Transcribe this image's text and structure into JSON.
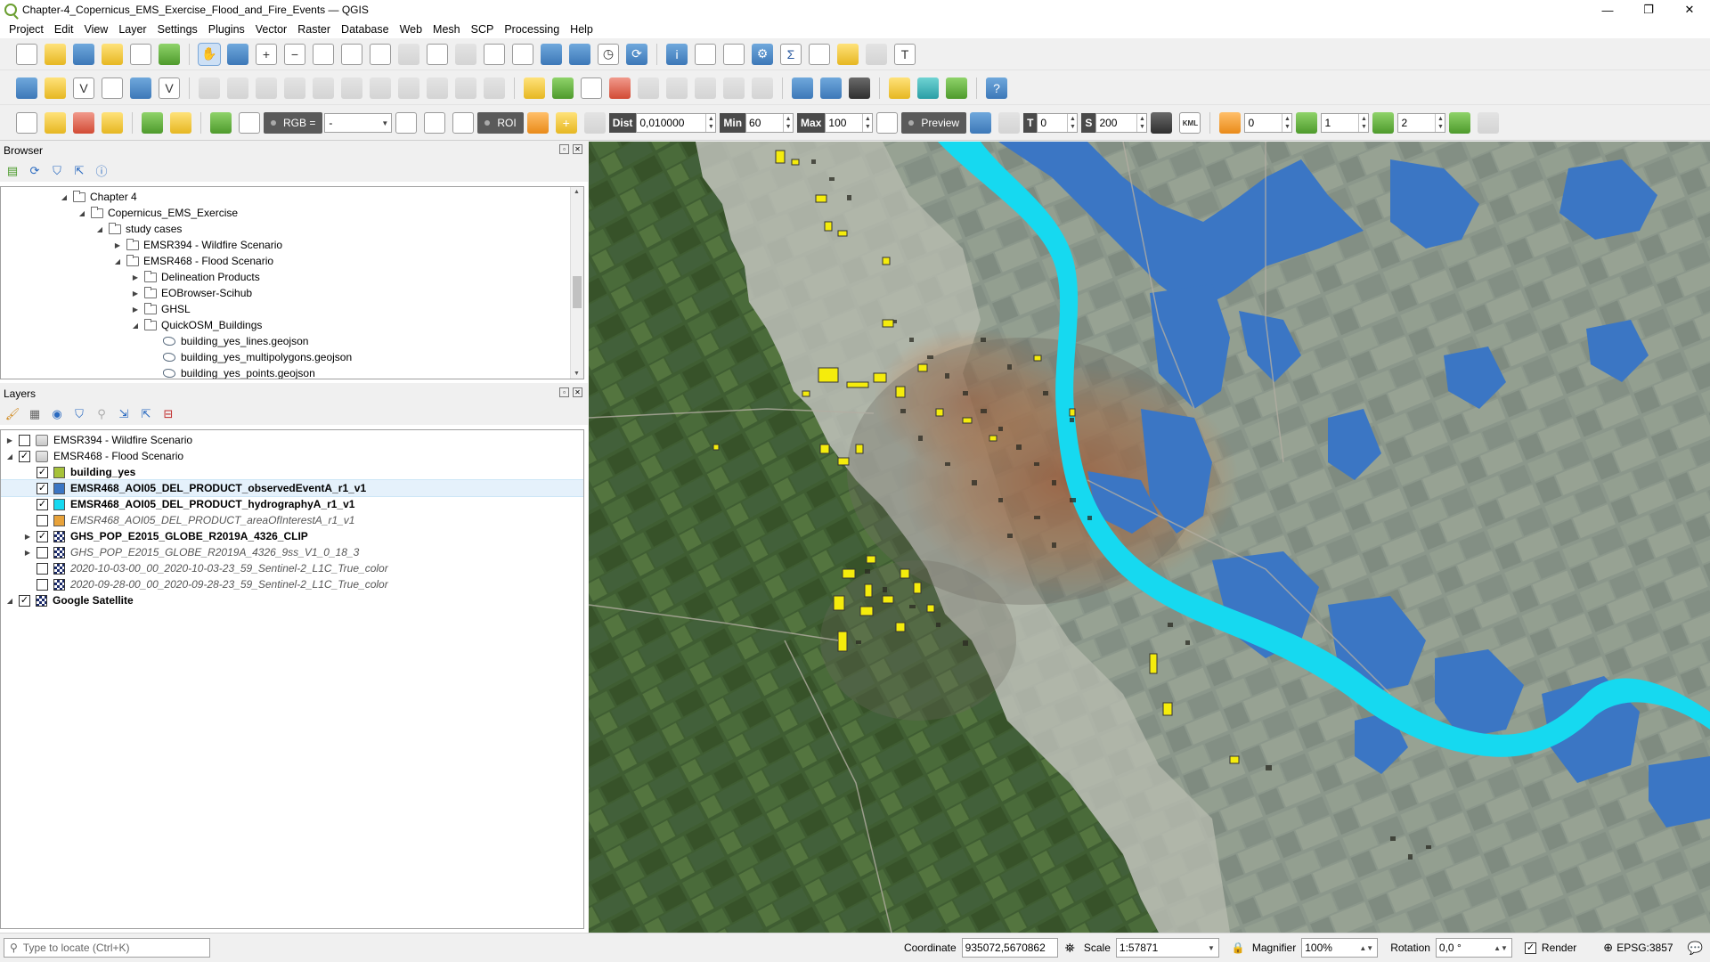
{
  "window": {
    "title": "Chapter-4_Copernicus_EMS_Exercise_Flood_and_Fire_Events — QGIS",
    "controls": {
      "minimize": "—",
      "restore": "❐",
      "close": "✕"
    }
  },
  "menu": [
    "Project",
    "Edit",
    "View",
    "Layer",
    "Settings",
    "Plugins",
    "Vector",
    "Raster",
    "Database",
    "Web",
    "Mesh",
    "SCP",
    "Processing",
    "Help"
  ],
  "scp_toolbar": {
    "rgb_label": "RGB =",
    "rgb_value": "-",
    "roi_label": "ROI",
    "dist_label": "Dist",
    "dist_value": "0,010000",
    "min_label": "Min",
    "min_value": "60",
    "max_label": "Max",
    "max_value": "100",
    "preview_label": "Preview",
    "t_label": "T",
    "t_value": "0",
    "s_label": "S",
    "s_value": "200",
    "kml_label": "KML",
    "band_a": "0",
    "band_b": "1",
    "band_c": "2"
  },
  "browser": {
    "title": "Browser",
    "items": [
      {
        "label": "Chapter 4",
        "indent": 0,
        "expander": "open",
        "icon": "folder"
      },
      {
        "label": "Copernicus_EMS_Exercise",
        "indent": 1,
        "expander": "open",
        "icon": "folder"
      },
      {
        "label": "study cases",
        "indent": 2,
        "expander": "open",
        "icon": "folder"
      },
      {
        "label": "EMSR394 - Wildfire Scenario",
        "indent": 3,
        "expander": "closed",
        "icon": "folder"
      },
      {
        "label": "EMSR468 - Flood Scenario",
        "indent": 3,
        "expander": "open",
        "icon": "folder"
      },
      {
        "label": "Delineation Products",
        "indent": 4,
        "expander": "closed",
        "icon": "folder"
      },
      {
        "label": "EOBrowser-Scihub",
        "indent": 4,
        "expander": "closed",
        "icon": "folder"
      },
      {
        "label": "GHSL",
        "indent": 4,
        "expander": "closed",
        "icon": "folder"
      },
      {
        "label": "QuickOSM_Buildings",
        "indent": 4,
        "expander": "open",
        "icon": "folder"
      },
      {
        "label": "building_yes_lines.geojson",
        "indent": 5,
        "expander": "none",
        "icon": "geojson"
      },
      {
        "label": "building_yes_multipolygons.geojson",
        "indent": 5,
        "expander": "none",
        "icon": "geojson"
      },
      {
        "label": "building_yes_points.geojson",
        "indent": 5,
        "expander": "none",
        "icon": "geojson"
      }
    ]
  },
  "layers": {
    "title": "Layers",
    "items": [
      {
        "label": "EMSR394 - Wildfire Scenario",
        "indent": 0,
        "expander": "closed",
        "checked": false,
        "sym": "group",
        "style": "normal"
      },
      {
        "label": "EMSR468 - Flood Scenario",
        "indent": 0,
        "expander": "open",
        "checked": true,
        "sym": "group",
        "style": "normal"
      },
      {
        "label": "building_yes",
        "indent": 1,
        "expander": "none",
        "checked": true,
        "sym": "fill",
        "color": "#a6c23a",
        "style": "bold"
      },
      {
        "label": "EMSR468_AOI05_DEL_PRODUCT_observedEventA_r1_v1",
        "indent": 1,
        "expander": "none",
        "checked": true,
        "sym": "fill",
        "color": "#3b76c4",
        "style": "bold",
        "highlight": true
      },
      {
        "label": "EMSR468_AOI05_DEL_PRODUCT_hydrographyA_r1_v1",
        "indent": 1,
        "expander": "none",
        "checked": true,
        "sym": "fill",
        "color": "#16d9f0",
        "style": "bold"
      },
      {
        "label": "EMSR468_AOI05_DEL_PRODUCT_areaOfInterestA_r1_v1",
        "indent": 1,
        "expander": "none",
        "checked": false,
        "sym": "fill",
        "color": "#e8a23a",
        "style": "italic"
      },
      {
        "label": "GHS_POP_E2015_GLOBE_R2019A_4326_CLIP",
        "indent": 1,
        "expander": "closed",
        "checked": true,
        "sym": "raster",
        "style": "bold"
      },
      {
        "label": "GHS_POP_E2015_GLOBE_R2019A_4326_9ss_V1_0_18_3",
        "indent": 1,
        "expander": "closed",
        "checked": false,
        "sym": "raster",
        "style": "italic"
      },
      {
        "label": "2020-10-03-00_00_2020-10-03-23_59_Sentinel-2_L1C_True_color",
        "indent": 1,
        "expander": "none",
        "checked": false,
        "sym": "raster",
        "style": "italic"
      },
      {
        "label": "2020-09-28-00_00_2020-09-28-23_59_Sentinel-2_L1C_True_color",
        "indent": 1,
        "expander": "none",
        "checked": false,
        "sym": "raster",
        "style": "italic"
      },
      {
        "label": "Google Satellite",
        "indent": 0,
        "expander": "open",
        "checked": true,
        "sym": "raster",
        "style": "bold"
      }
    ]
  },
  "status": {
    "locate_placeholder": "Type to locate (Ctrl+K)",
    "coordinate_label": "Coordinate",
    "coordinate_value": "935072,5670862",
    "scale_label": "Scale",
    "scale_value": "1:57871",
    "magnifier_label": "Magnifier",
    "magnifier_value": "100%",
    "rotation_label": "Rotation",
    "rotation_value": "0,0 °",
    "render_label": "Render",
    "crs_label": "EPSG:3857"
  },
  "colors": {
    "river": "#16d9f0",
    "flood": "#3b76c4",
    "buildings": "#f5ec0c",
    "population": "#b5582a"
  }
}
